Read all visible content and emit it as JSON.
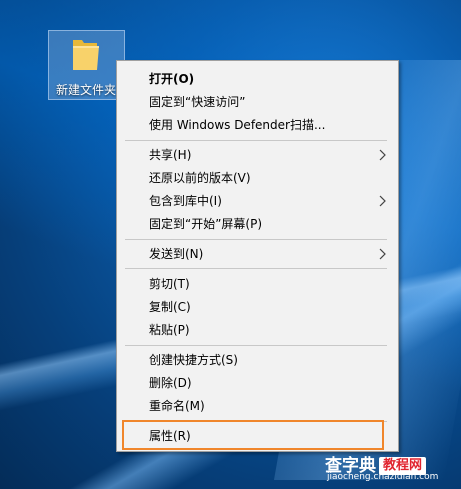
{
  "desktop": {
    "folder_label": "新建文件夹"
  },
  "context_menu": {
    "items": [
      {
        "label": "打开(O)",
        "bold": true
      },
      {
        "label": "固定到“快速访问”"
      },
      {
        "label": "使用 Windows Defender扫描..."
      },
      {
        "label": "共享(H)",
        "submenu": true
      },
      {
        "label": "还原以前的版本(V)"
      },
      {
        "label": "包含到库中(I)",
        "submenu": true
      },
      {
        "label": "固定到“开始”屏幕(P)"
      },
      {
        "label": "发送到(N)",
        "submenu": true
      },
      {
        "label": "剪切(T)"
      },
      {
        "label": "复制(C)"
      },
      {
        "label": "粘贴(P)"
      },
      {
        "label": "创建快捷方式(S)"
      },
      {
        "label": "删除(D)"
      },
      {
        "label": "重命名(M)"
      },
      {
        "label": "属性(R)",
        "highlighted": true
      }
    ],
    "highlight_color": "#f0862b"
  },
  "watermark": {
    "brand": "查字典",
    "tag": "教程网",
    "url": "jiaocheng.chazidian.com"
  },
  "icons": {
    "folder": "folder-icon",
    "submenu_arrow": "chevron-right-icon"
  }
}
